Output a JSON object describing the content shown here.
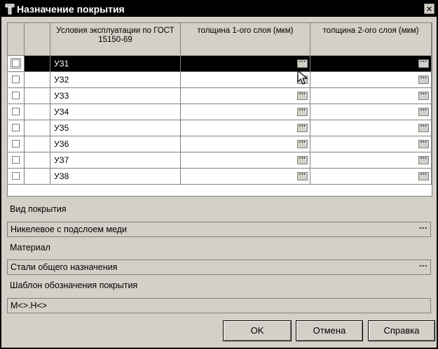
{
  "window": {
    "title": "Назначение покрытия",
    "close_glyph": "✕"
  },
  "grid": {
    "columns": [
      "",
      "",
      "Условия эксплуатации по ГОСТ 15150-69",
      "толщина 1-ого слоя (мкм)",
      "толщина 2-ого слоя (мкм)"
    ],
    "rows": [
      {
        "label": "УЗ1",
        "thick1": "",
        "thick2": "",
        "selected": true
      },
      {
        "label": "УЗ2",
        "thick1": "",
        "thick2": "",
        "selected": false
      },
      {
        "label": "УЗ3",
        "thick1": "",
        "thick2": "",
        "selected": false
      },
      {
        "label": "УЗ4",
        "thick1": "",
        "thick2": "",
        "selected": false
      },
      {
        "label": "УЗ5",
        "thick1": "",
        "thick2": "",
        "selected": false
      },
      {
        "label": "УЗ6",
        "thick1": "",
        "thick2": "",
        "selected": false
      },
      {
        "label": "УЗ7",
        "thick1": "",
        "thick2": "",
        "selected": false
      },
      {
        "label": "УЗ8",
        "thick1": "",
        "thick2": "",
        "selected": false
      }
    ],
    "ellipsis": "···"
  },
  "form": {
    "coating_type_label": "Вид покрытия",
    "coating_type_value": "Никелевое с подслоем меди",
    "material_label": "Материал",
    "material_value": "Стали общего назначения",
    "template_label": "Шаблон обозначения покрытия",
    "template_value": "M<>.H<>"
  },
  "buttons": {
    "ok": "OK",
    "cancel": "Отмена",
    "help": "Справка"
  }
}
